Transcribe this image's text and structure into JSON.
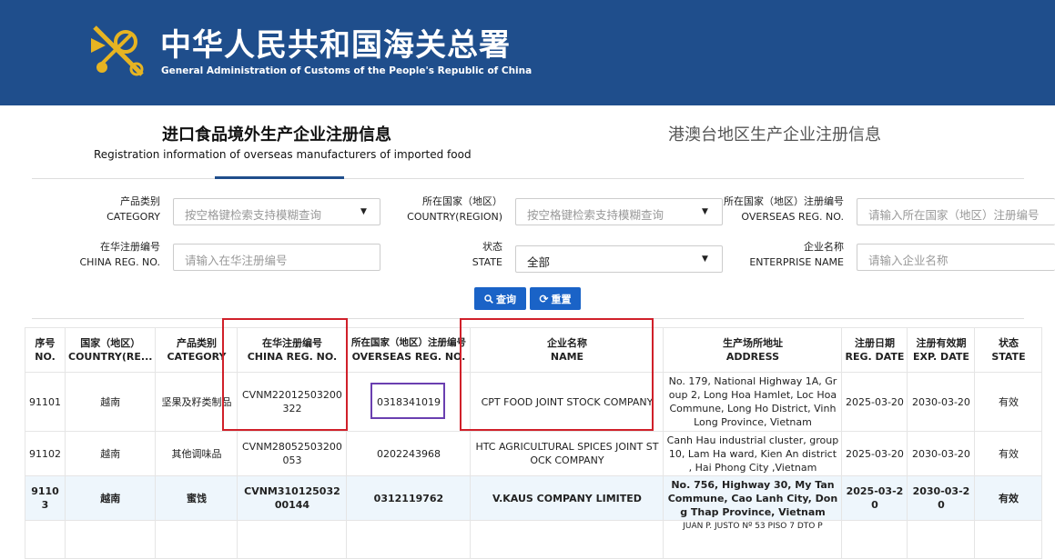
{
  "header": {
    "title_cn": "中华人民共和国海关总署",
    "title_en": "General Administration of Customs of the People's Republic of China",
    "bg_color": "#1f4e8c"
  },
  "tabs": [
    {
      "label_cn": "进口食品境外生产企业注册信息",
      "label_en": "Registration information of overseas manufacturers of imported food",
      "active": true
    },
    {
      "label_cn": "港澳台地区生产企业注册信息",
      "active": false
    }
  ],
  "filters": {
    "category": {
      "label_cn": "产品类别",
      "label_en": "CATEGORY",
      "placeholder": "按空格键检索支持模糊查询"
    },
    "country": {
      "label_cn": "所在国家（地区）",
      "label_en": "COUNTRY(REGION)",
      "placeholder": "按空格键检索支持模糊查询"
    },
    "overseas_reg": {
      "label_cn": "所在国家（地区）注册编号",
      "label_en": "OVERSEAS REG. NO.",
      "placeholder": "请输入所在国家（地区）注册编号"
    },
    "china_reg": {
      "label_cn": "在华注册编号",
      "label_en": "CHINA REG. NO.",
      "placeholder": "请输入在华注册编号"
    },
    "state": {
      "label_cn": "状态",
      "label_en": "STATE",
      "value": "全部"
    },
    "enterprise": {
      "label_cn": "企业名称",
      "label_en": "ENTERPRISE NAME",
      "placeholder": "请输入企业名称"
    }
  },
  "buttons": {
    "search": "查询",
    "reset": "重置",
    "accent": "#1a63c7"
  },
  "table": {
    "headers": [
      {
        "cn": "序号",
        "en": "NO."
      },
      {
        "cn": "国家（地区）",
        "en": "COUNTRY(RE..."
      },
      {
        "cn": "产品类别",
        "en": "CATEGORY"
      },
      {
        "cn": "在华注册编号",
        "en": "CHINA REG. NO."
      },
      {
        "cn": "所在国家（地区）注册编号",
        "en": "OVERSEAS REG. NO."
      },
      {
        "cn": "企业名称",
        "en": "NAME"
      },
      {
        "cn": "生产场所地址",
        "en": "ADDRESS"
      },
      {
        "cn": "注册日期",
        "en": "REG. DATE"
      },
      {
        "cn": "注册有效期",
        "en": "EXP. DATE"
      },
      {
        "cn": "状态",
        "en": "STATE"
      }
    ],
    "rows": [
      [
        "91101",
        "越南",
        "坚果及籽类制品",
        "CVNM22012503200322",
        "0318341019",
        "CPT FOOD JOINT STOCK COMPANY",
        "No. 179, National Highway 1A, Group 2, Long Hoa Hamlet, Loc Hoa Commune, Long Ho District, Vinh Long Province, Vietnam",
        "2025-03-20",
        "2030-03-20",
        "有效"
      ],
      [
        "91102",
        "越南",
        "其他调味品",
        "CVNM28052503200053",
        "0202243968",
        "HTC AGRICULTURAL SPICES JOINT STOCK COMPANY",
        "Canh Hau industrial cluster, group 10, Lam Ha ward, Kien An district , Hai Phong City ,Vietnam",
        "2025-03-20",
        "2030-03-20",
        "有效"
      ],
      [
        "91103",
        "越南",
        "蜜饯",
        "CVNM31012503200144",
        "0312119762",
        "V.KAUS COMPANY LIMITED",
        "No. 756, Highway 30, My Tan Commune, Cao Lanh City, Dong Thap Province, Vietnam",
        "2025-03-20",
        "2030-03-20",
        "有效"
      ],
      [
        "",
        "",
        "",
        "",
        "",
        "",
        "JUAN P. JUSTO Nº 53 PISO 7 DTO P",
        "",
        "",
        ""
      ]
    ]
  },
  "annotation_colors": {
    "red": "#d0202a",
    "purple": "#6a3fb0"
  }
}
